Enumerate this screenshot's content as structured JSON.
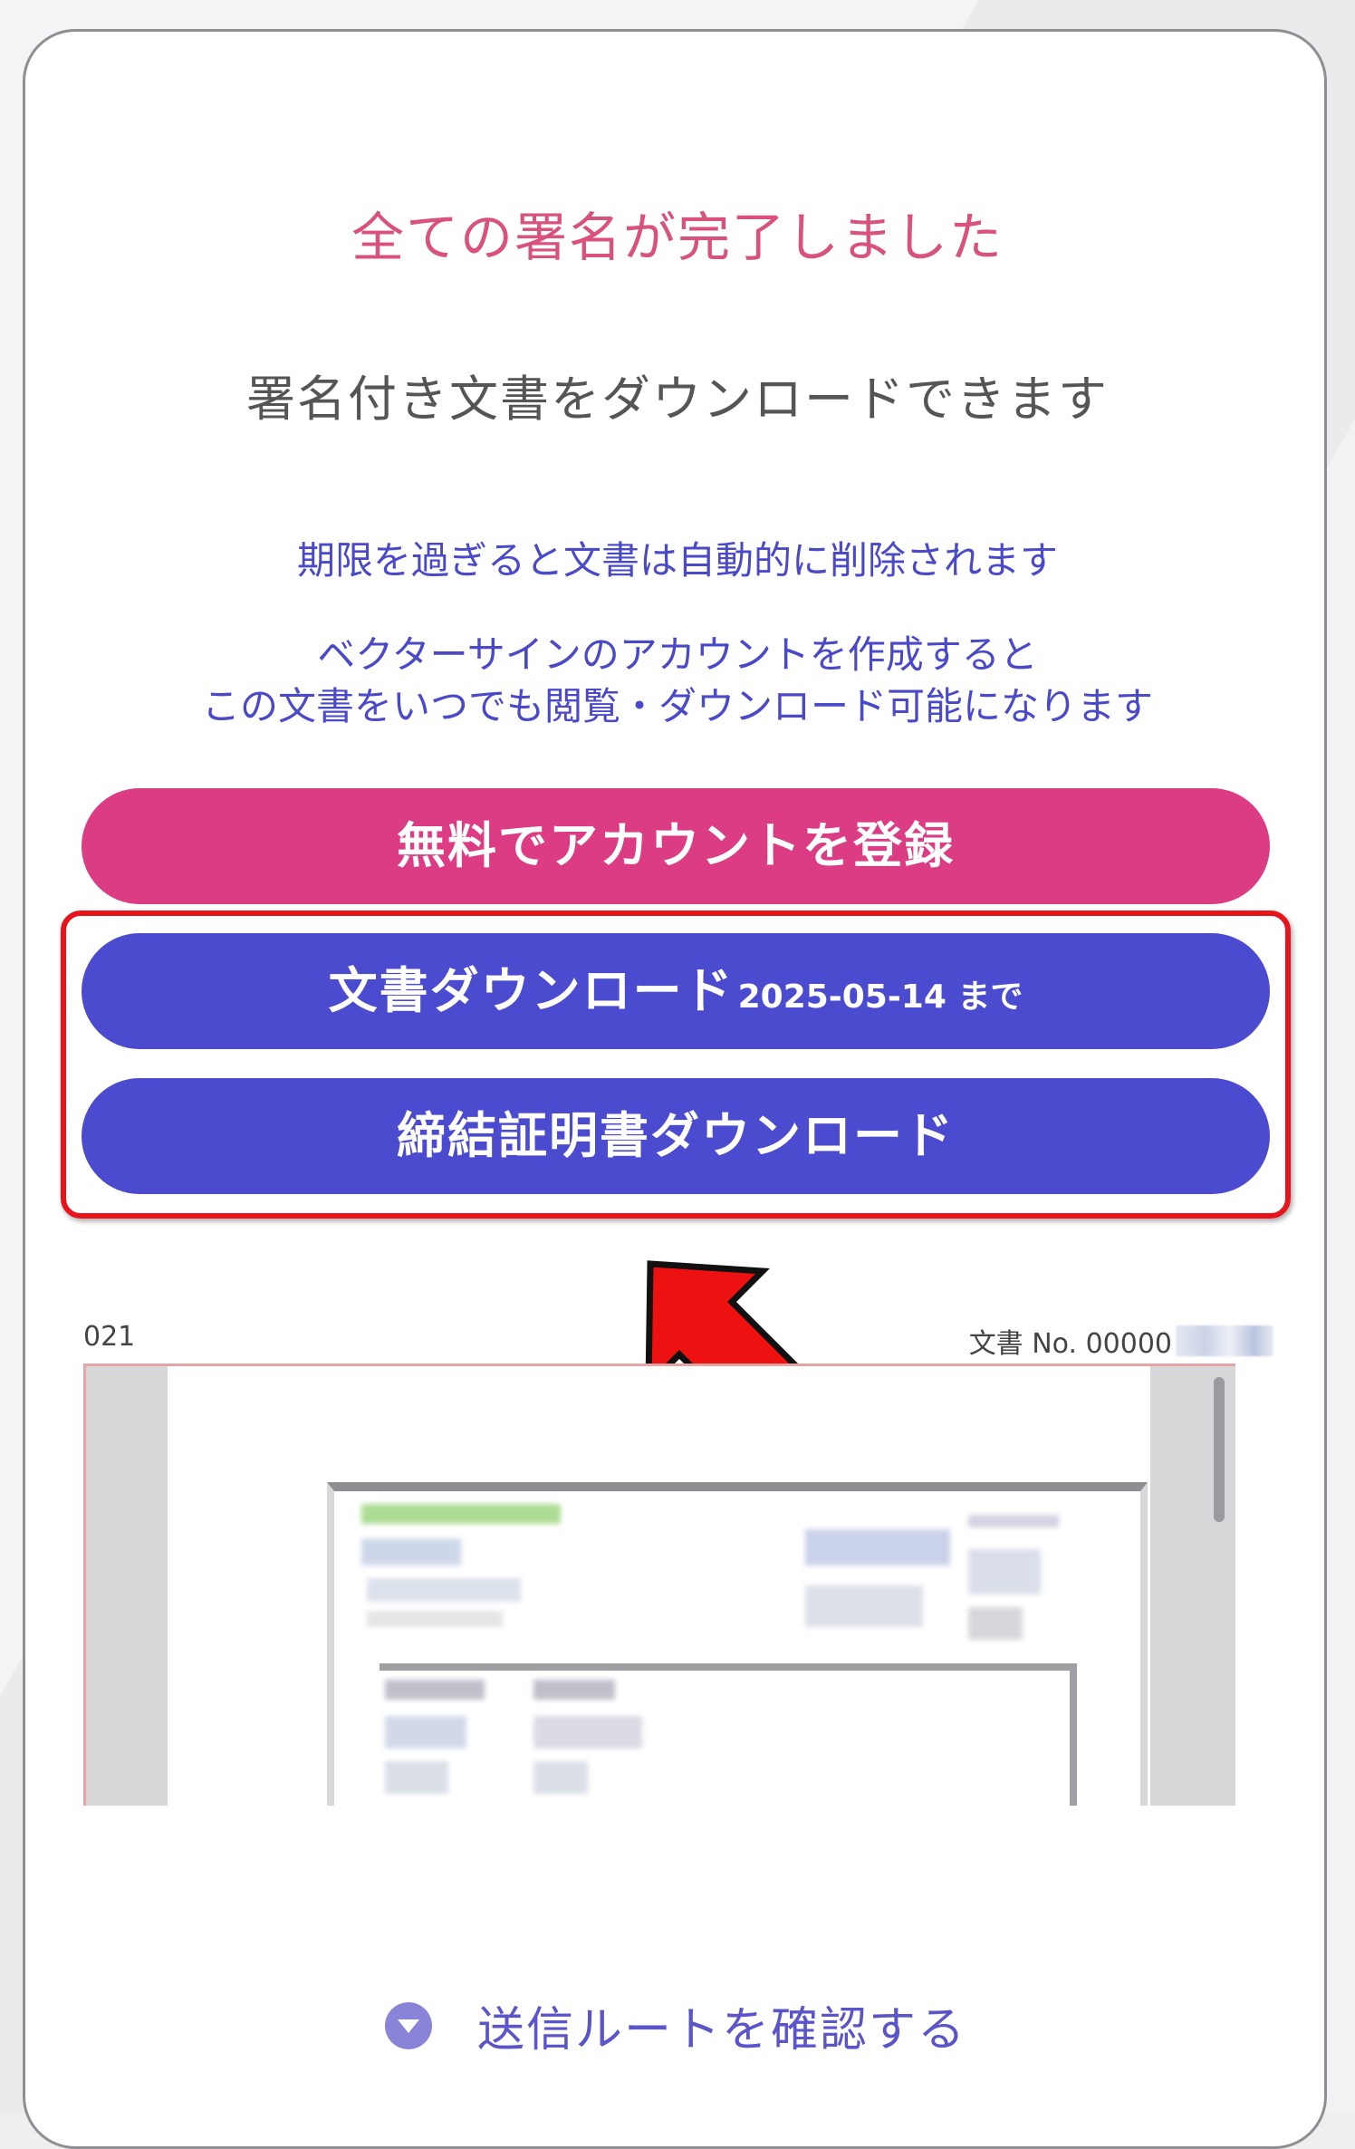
{
  "header": {
    "title": "全ての署名が完了しました",
    "subtitle": "署名付き文書をダウンロードできます"
  },
  "notes": {
    "expiry": "期限を過ぎると文書は自動的に削除されます",
    "account_line1": "ベクターサインのアカウントを作成すると",
    "account_line2": "この文書をいつでも閲覧・ダウンロード可能になります"
  },
  "buttons": {
    "register_label": "無料でアカウントを登録",
    "document_download_label": "文書ダウンロード",
    "document_download_deadline": "2025-05-14 まで",
    "certificate_download_label": "締結証明書ダウンロード"
  },
  "preview": {
    "left_meta": "021",
    "doc_number_label": "文書 No. 00000"
  },
  "route": {
    "label": "送信ルートを確認する",
    "icon": "chevron-down-circle-icon"
  },
  "colors": {
    "title": "#d8527c",
    "register_button": "#db3c84",
    "download_button": "#4b4bcf",
    "note_text": "#4a4ac9",
    "highlight_border": "#e8141c",
    "arrow": "#ee1111"
  }
}
